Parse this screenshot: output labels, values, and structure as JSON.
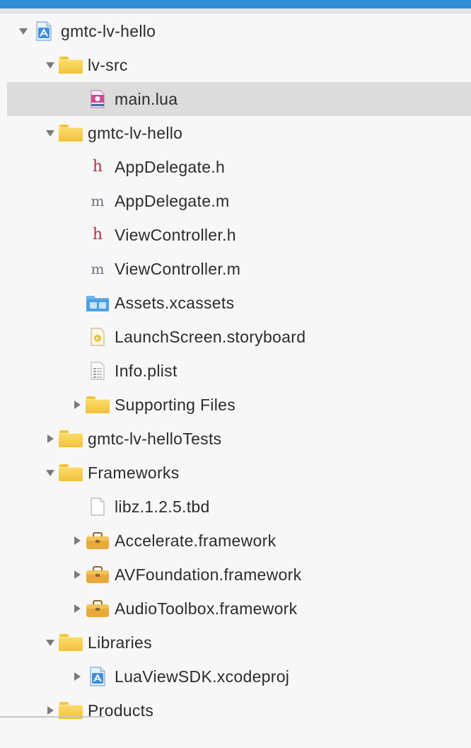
{
  "colors": {
    "accent": "#2f8fd6",
    "selection": "#dcdcdc",
    "folder": "#f6cc45",
    "text": "#2c2c2c"
  },
  "tree": [
    {
      "name": "gmtc-lv-hello",
      "level": 0,
      "expanded": true,
      "icon": "xcode-project-icon"
    },
    {
      "name": "lv-src",
      "level": 1,
      "expanded": true,
      "icon": "folder-icon"
    },
    {
      "name": "main.lua",
      "level": 2,
      "icon": "lua-file-icon",
      "selected": true
    },
    {
      "name": "gmtc-lv-hello",
      "level": 1,
      "expanded": true,
      "icon": "folder-icon"
    },
    {
      "name": "AppDelegate.h",
      "level": 2,
      "icon": "header-file-icon"
    },
    {
      "name": "AppDelegate.m",
      "level": 2,
      "icon": "objc-file-icon"
    },
    {
      "name": "ViewController.h",
      "level": 2,
      "icon": "header-file-icon"
    },
    {
      "name": "ViewController.m",
      "level": 2,
      "icon": "objc-file-icon"
    },
    {
      "name": "Assets.xcassets",
      "level": 2,
      "icon": "assets-catalog-icon"
    },
    {
      "name": "LaunchScreen.storyboard",
      "level": 2,
      "icon": "storyboard-icon"
    },
    {
      "name": "Info.plist",
      "level": 2,
      "icon": "plist-icon"
    },
    {
      "name": "Supporting Files",
      "level": 2,
      "expanded": false,
      "icon": "folder-icon"
    },
    {
      "name": "gmtc-lv-helloTests",
      "level": 1,
      "expanded": false,
      "icon": "folder-icon"
    },
    {
      "name": "Frameworks",
      "level": 1,
      "expanded": true,
      "icon": "folder-icon"
    },
    {
      "name": "libz.1.2.5.tbd",
      "level": 2,
      "icon": "document-icon"
    },
    {
      "name": "Accelerate.framework",
      "level": 2,
      "expanded": false,
      "icon": "framework-icon"
    },
    {
      "name": "AVFoundation.framework",
      "level": 2,
      "expanded": false,
      "icon": "framework-icon"
    },
    {
      "name": "AudioToolbox.framework",
      "level": 2,
      "expanded": false,
      "icon": "framework-icon"
    },
    {
      "name": "Libraries",
      "level": 1,
      "expanded": true,
      "icon": "folder-icon"
    },
    {
      "name": "LuaViewSDK.xcodeproj",
      "level": 2,
      "expanded": false,
      "icon": "xcode-project-icon"
    },
    {
      "name": "Products",
      "level": 1,
      "expanded": false,
      "icon": "folder-icon"
    }
  ]
}
